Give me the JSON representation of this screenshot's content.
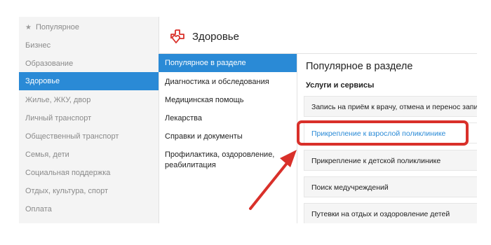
{
  "categories": [
    {
      "label": "Популярное",
      "icon": "star-icon",
      "active": false
    },
    {
      "label": "Бизнес",
      "active": false
    },
    {
      "label": "Образование",
      "active": false
    },
    {
      "label": "Здоровье",
      "active": true
    },
    {
      "label": "Жилье, ЖКУ, двор",
      "active": false
    },
    {
      "label": "Личный транспорт",
      "active": false
    },
    {
      "label": "Общественный транспорт",
      "active": false
    },
    {
      "label": "Семья, дети",
      "active": false
    },
    {
      "label": "Социальная поддержка",
      "active": false
    },
    {
      "label": "Отдых, культура, спорт",
      "active": false
    },
    {
      "label": "Оплата",
      "active": false
    }
  ],
  "section": {
    "title": "Здоровье",
    "icon": "health-heart-icon"
  },
  "subcategories": [
    {
      "label": "Популярное в разделе",
      "active": true
    },
    {
      "label": "Диагностика и обследования",
      "active": false
    },
    {
      "label": "Медицинская помощь",
      "active": false
    },
    {
      "label": "Лекарства",
      "active": false
    },
    {
      "label": "Справки и документы",
      "active": false
    },
    {
      "label": "Профилактика, оздоровление, реабилитация",
      "active": false
    }
  ],
  "panel": {
    "title": "Популярное в разделе",
    "subtitle": "Услуги и сервисы",
    "services": [
      {
        "label": "Запись на приём к врачу, отмена и перенос записи"
      },
      {
        "label": "Прикрепление к взрослой поликлинике",
        "highlighted": true
      },
      {
        "label": "Прикрепление к детской поликлинике"
      },
      {
        "label": "Поиск медучреждений"
      },
      {
        "label": "Путевки на отдых и оздоровление детей"
      }
    ]
  },
  "colors": {
    "accent": "#2a8ad6",
    "annotation": "#d9302a"
  }
}
